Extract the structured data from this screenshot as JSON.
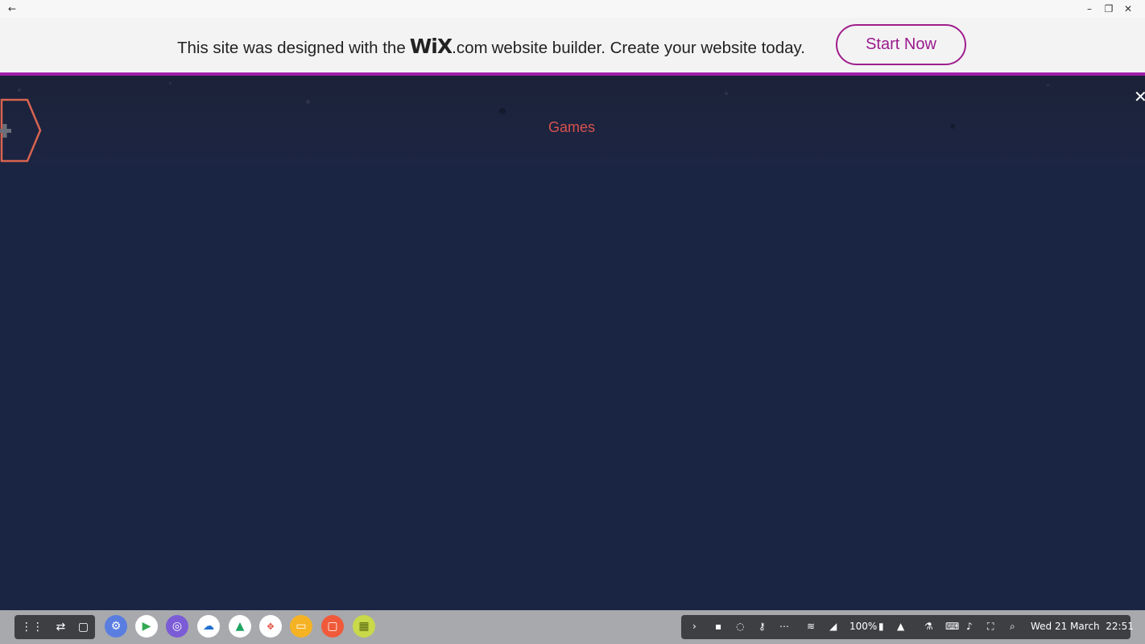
{
  "window": {
    "back_icon": "arrow-left-icon",
    "minimize_icon": "minimize-icon",
    "restore_icon": "restore-icon",
    "close_icon": "close-icon"
  },
  "banner": {
    "text_before": "This site was designed with the",
    "logo": "WiX",
    "logo_domain": ".com",
    "text_after": "website builder. Create your website today.",
    "button_label": "Start Now",
    "accent_color": "#a01ea8"
  },
  "site": {
    "nav_link": "Games",
    "nav_color": "#d8524f",
    "background_color": "#1a2544"
  },
  "taskbar": {
    "left_icons": [
      "launcher-icon",
      "switch-icon",
      "window-icon"
    ],
    "apps": [
      {
        "name": "settings-app-icon"
      },
      {
        "name": "play-store-icon"
      },
      {
        "name": "browser-icon"
      },
      {
        "name": "onedrive-icon"
      },
      {
        "name": "google-drive-icon"
      },
      {
        "name": "app-suite-icon"
      },
      {
        "name": "files-icon"
      },
      {
        "name": "screen-recorder-icon"
      },
      {
        "name": "calculator-icon"
      }
    ],
    "battery": "100%",
    "datetime": "Wed 21 March  22:51"
  }
}
